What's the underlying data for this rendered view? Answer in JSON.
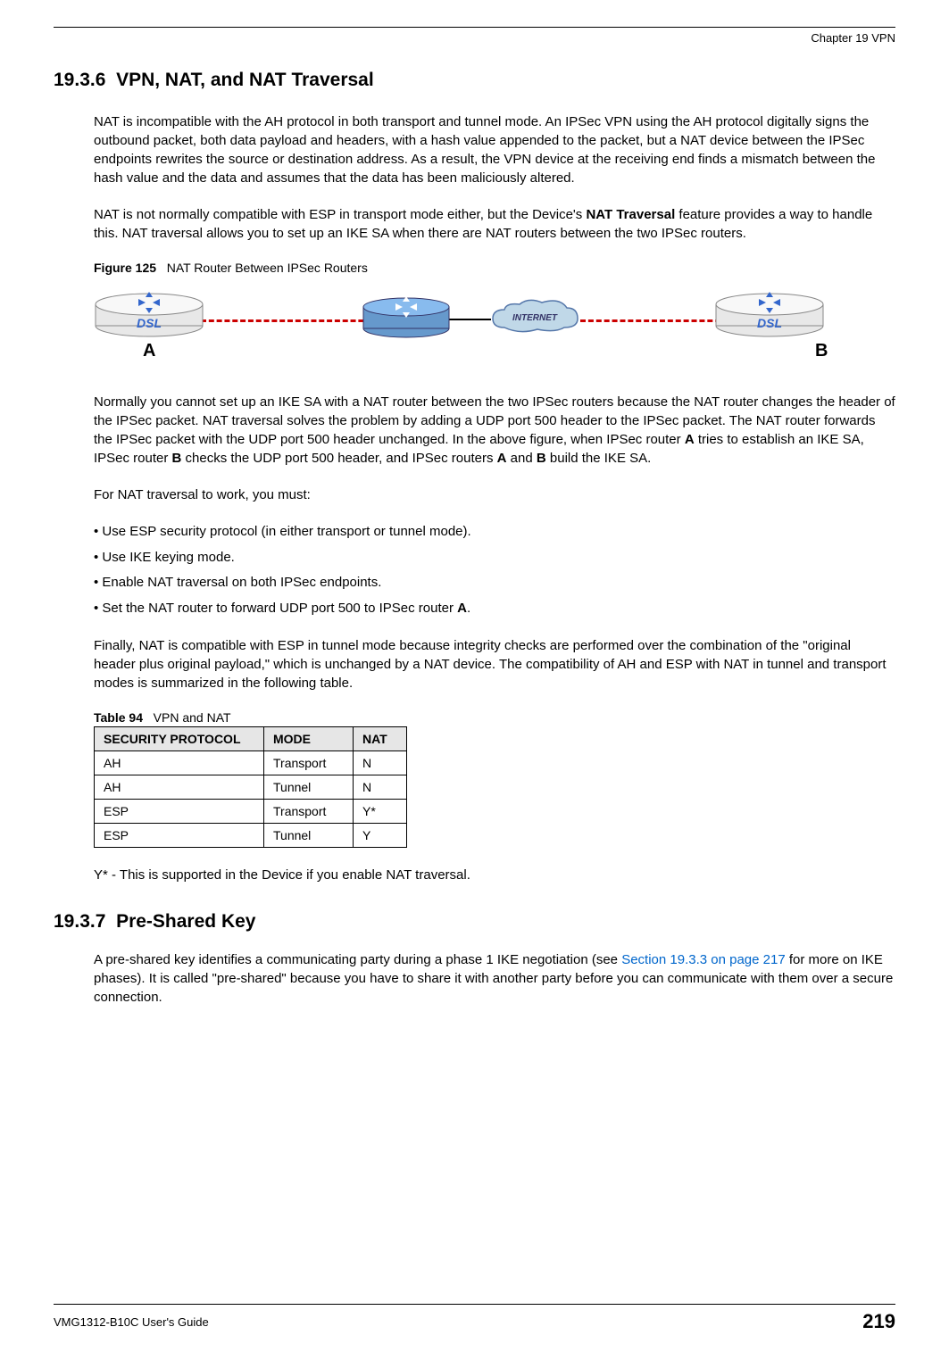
{
  "header": {
    "chapter": "Chapter 19 VPN"
  },
  "section1": {
    "number": "19.3.6",
    "title": "VPN, NAT, and NAT Traversal",
    "para1": "NAT is incompatible with the AH protocol in both transport and tunnel mode. An IPSec VPN using the AH protocol digitally signs the outbound packet, both data payload and headers, with a hash value appended to the packet, but a NAT device between the IPSec endpoints rewrites the source or destination address. As a result, the VPN device at the receiving end finds a mismatch between the hash value and the data and assumes that the data has been maliciously altered.",
    "para2_pre": "NAT is not normally compatible with ESP in transport mode either, but the Device's ",
    "para2_bold": "NAT Traversal",
    "para2_post": " feature provides a way to handle this. NAT traversal allows you to set up an IKE SA when there are NAT routers between the two IPSec routers.",
    "figure_label": "Figure 125",
    "figure_title": "NAT Router Between IPSec Routers",
    "figure_labelA": "A",
    "figure_labelB": "B",
    "para3_pre": "Normally you cannot set up an IKE SA with a NAT router between the two IPSec routers because the NAT router changes the header of the IPSec packet. NAT traversal solves the problem by adding a UDP port 500 header to the IPSec packet. The NAT router forwards the IPSec packet with the UDP port 500 header unchanged. In the above figure, when IPSec router ",
    "para3_A1": "A",
    "para3_mid1": " tries to establish an IKE SA, IPSec router ",
    "para3_B": "B",
    "para3_mid2": " checks the UDP port 500 header, and IPSec routers ",
    "para3_A2": "A",
    "para3_and": " and ",
    "para3_B2": "B",
    "para3_end": " build the IKE SA.",
    "para4": "For NAT traversal to work, you must:",
    "bullets": [
      "Use ESP security protocol (in either transport or tunnel mode).",
      "Use IKE keying mode.",
      "Enable NAT traversal on both IPSec endpoints."
    ],
    "bullet4_pre": "Set the NAT router to forward UDP port 500 to IPSec router ",
    "bullet4_bold": "A",
    "bullet4_post": ".",
    "para5": "Finally, NAT is compatible with ESP in tunnel mode because integrity checks are performed over the combination of the \"original header plus original payload,\" which is unchanged by a NAT device. The compatibility of AH and ESP with NAT in tunnel and transport modes is summarized in the following table.",
    "table_label": "Table 94",
    "table_title": "VPN and NAT",
    "table": {
      "headers": [
        "SECURITY PROTOCOL",
        "MODE",
        "NAT"
      ],
      "rows": [
        [
          "AH",
          "Transport",
          "N"
        ],
        [
          "AH",
          "Tunnel",
          "N"
        ],
        [
          "ESP",
          "Transport",
          "Y*"
        ],
        [
          "ESP",
          "Tunnel",
          "Y"
        ]
      ]
    },
    "note": "Y* - This is supported in the Device if you enable NAT traversal."
  },
  "section2": {
    "number": "19.3.7",
    "title": "Pre-Shared Key",
    "para1_pre": "A pre-shared key identifies a communicating party during a phase 1 IKE negotiation (see ",
    "para1_link": "Section 19.3.3 on page 217",
    "para1_post": " for more on IKE phases). It is called \"pre-shared\" because you have to share it with another party before you can communicate with them over a secure connection."
  },
  "footer": {
    "guide": "VMG1312-B10C User's Guide",
    "page": "219"
  }
}
